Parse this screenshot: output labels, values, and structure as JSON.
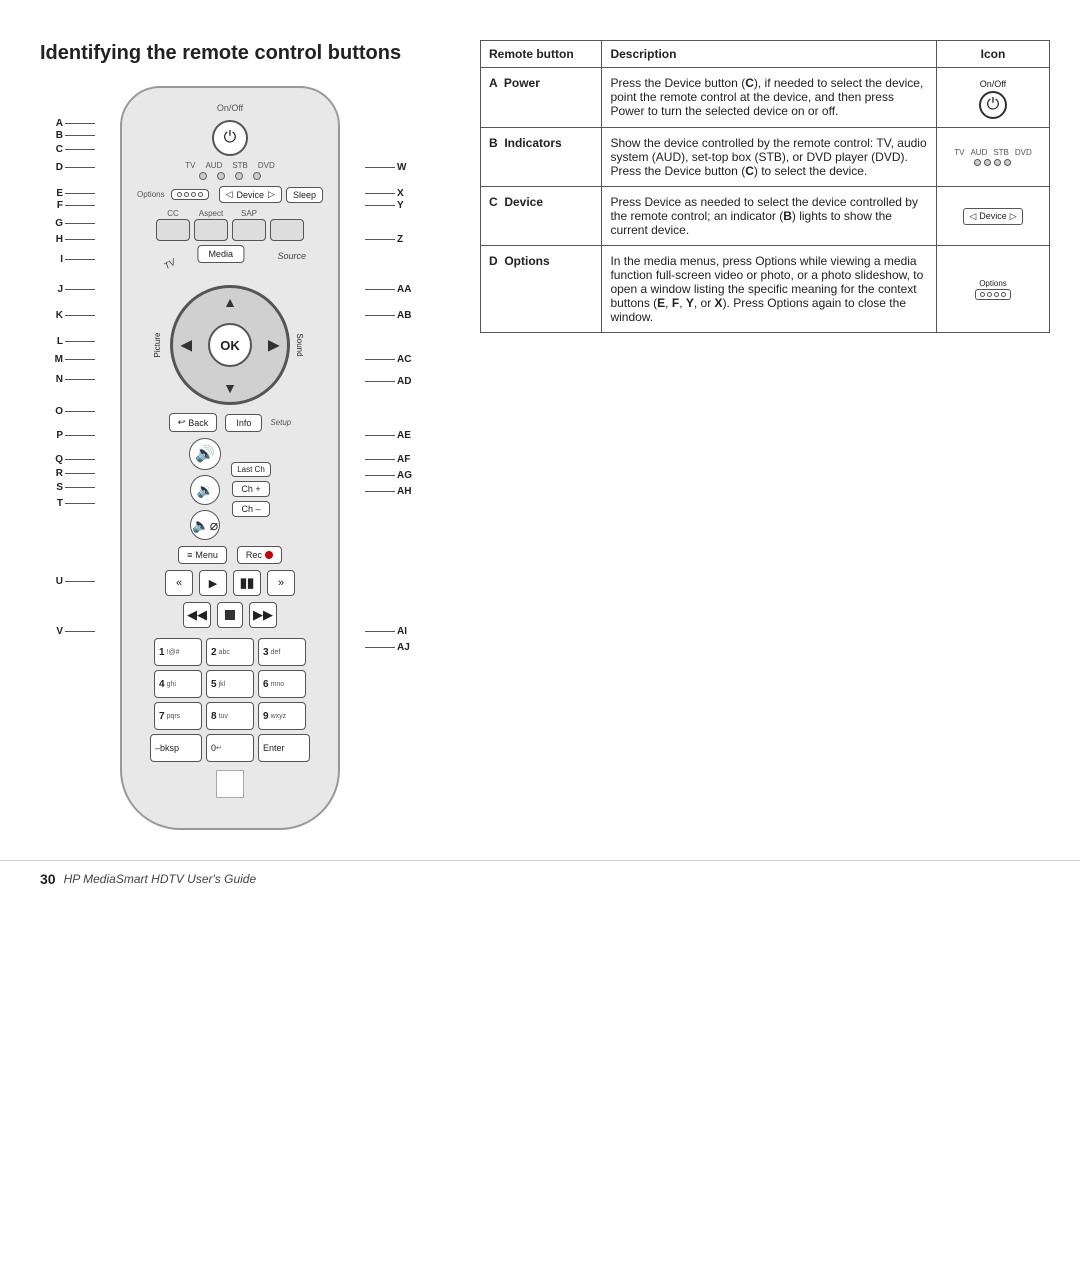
{
  "page": {
    "title": "Identifying the remote control buttons",
    "footer": {
      "page_number": "30",
      "guide_title": "HP MediaSmart HDTV User's Guide"
    }
  },
  "remote": {
    "labels_left": [
      {
        "id": "A",
        "text": "A"
      },
      {
        "id": "B",
        "text": "B"
      },
      {
        "id": "C",
        "text": "C"
      },
      {
        "id": "D",
        "text": "D"
      },
      {
        "id": "E",
        "text": "E"
      },
      {
        "id": "F",
        "text": "F"
      },
      {
        "id": "G",
        "text": "G"
      },
      {
        "id": "H",
        "text": "H"
      },
      {
        "id": "I",
        "text": "I"
      },
      {
        "id": "J",
        "text": "J"
      },
      {
        "id": "K",
        "text": "K"
      },
      {
        "id": "L",
        "text": "L"
      },
      {
        "id": "M",
        "text": "M"
      },
      {
        "id": "N",
        "text": "N"
      },
      {
        "id": "O",
        "text": "O"
      },
      {
        "id": "P",
        "text": "P"
      },
      {
        "id": "Q",
        "text": "Q"
      },
      {
        "id": "R",
        "text": "R"
      },
      {
        "id": "S",
        "text": "S"
      },
      {
        "id": "T",
        "text": "T"
      },
      {
        "id": "U",
        "text": "U"
      },
      {
        "id": "V",
        "text": "V"
      }
    ],
    "labels_right": [
      {
        "id": "W",
        "text": "W"
      },
      {
        "id": "X",
        "text": "X"
      },
      {
        "id": "Y",
        "text": "Y"
      },
      {
        "id": "Z",
        "text": "Z"
      },
      {
        "id": "AA",
        "text": "AA"
      },
      {
        "id": "AB",
        "text": "AB"
      },
      {
        "id": "AC",
        "text": "AC"
      },
      {
        "id": "AD",
        "text": "AD"
      },
      {
        "id": "AE",
        "text": "AE"
      },
      {
        "id": "AF",
        "text": "AF"
      },
      {
        "id": "AG",
        "text": "AG"
      },
      {
        "id": "AH",
        "text": "AH"
      },
      {
        "id": "AI",
        "text": "AI"
      },
      {
        "id": "AJ",
        "text": "AJ"
      }
    ],
    "buttons": {
      "power": "On/Off",
      "indicators": [
        "TV",
        "AUD",
        "STB",
        "DVD"
      ],
      "options": "Options",
      "device": "Device",
      "sleep": "Sleep",
      "cc": "CC",
      "aspect": "Aspect",
      "sap": "SAP",
      "media": "Media",
      "source": "Source",
      "tv": "TV",
      "ok": "OK",
      "picture": "Picture",
      "sound": "Sound",
      "back": "Back",
      "info": "Info",
      "setup": "Setup",
      "volume_up": "🔊",
      "last_ch": "Last Ch",
      "ch_plus": "Ch +",
      "volume_down": "🔉",
      "mute": "🔇",
      "ch_minus": "Ch –",
      "menu": "Menu",
      "rec": "Rec",
      "rew": "«",
      "play": "▶",
      "pause": "⏸",
      "fwd": "»",
      "prev": "⏮",
      "stop": "■",
      "next": "⏭",
      "num1": "1",
      "num1sub": "@#",
      "num2": "2",
      "num2sub": "abc",
      "num3": "3",
      "num3sub": "def",
      "num4": "4",
      "num4sub": "ghi",
      "num5": "5",
      "num5sub": "jkl",
      "num6": "6",
      "num6sub": "mno",
      "num7": "7",
      "num7sub": "pqrs",
      "num8": "8",
      "num8sub": "tuv",
      "num9": "9",
      "num9sub": "wxyz",
      "bksp": "–bksp",
      "num0": "0",
      "num0sub": "↵",
      "enter": "Enter"
    }
  },
  "table": {
    "headers": {
      "remote_button": "Remote button",
      "description": "Description",
      "icon": "Icon"
    },
    "rows": [
      {
        "button_letter": "A",
        "button_name": "Power",
        "description": "Press the Device button (C), if needed to select the device, point the remote control at the device, and then press Power to turn the selected device on or off.",
        "icon_type": "power",
        "icon_label": "On/Off"
      },
      {
        "button_letter": "B",
        "button_name": "Indicators",
        "description": "Show the device controlled by the remote control: TV, audio system (AUD), set-top box (STB), or DVD player (DVD). Press the Device button (C) to select the device.",
        "icon_type": "indicators",
        "icon_label": "TV AUD STB DVD"
      },
      {
        "button_letter": "C",
        "button_name": "Device",
        "description": "Press Device as needed to select the device controlled by the remote control; an indicator (B) lights to show the current device.",
        "icon_type": "device",
        "icon_label": "◁ Device ▷"
      },
      {
        "button_letter": "D",
        "button_name": "Options",
        "description": "In the media menus, press Options while viewing a media function full-screen video or photo, or a photo slideshow, to open a window listing the specific meaning for the context buttons (E, F, Y, or X). Press Options again to close the window.",
        "icon_type": "options",
        "icon_label": "Options"
      }
    ]
  }
}
